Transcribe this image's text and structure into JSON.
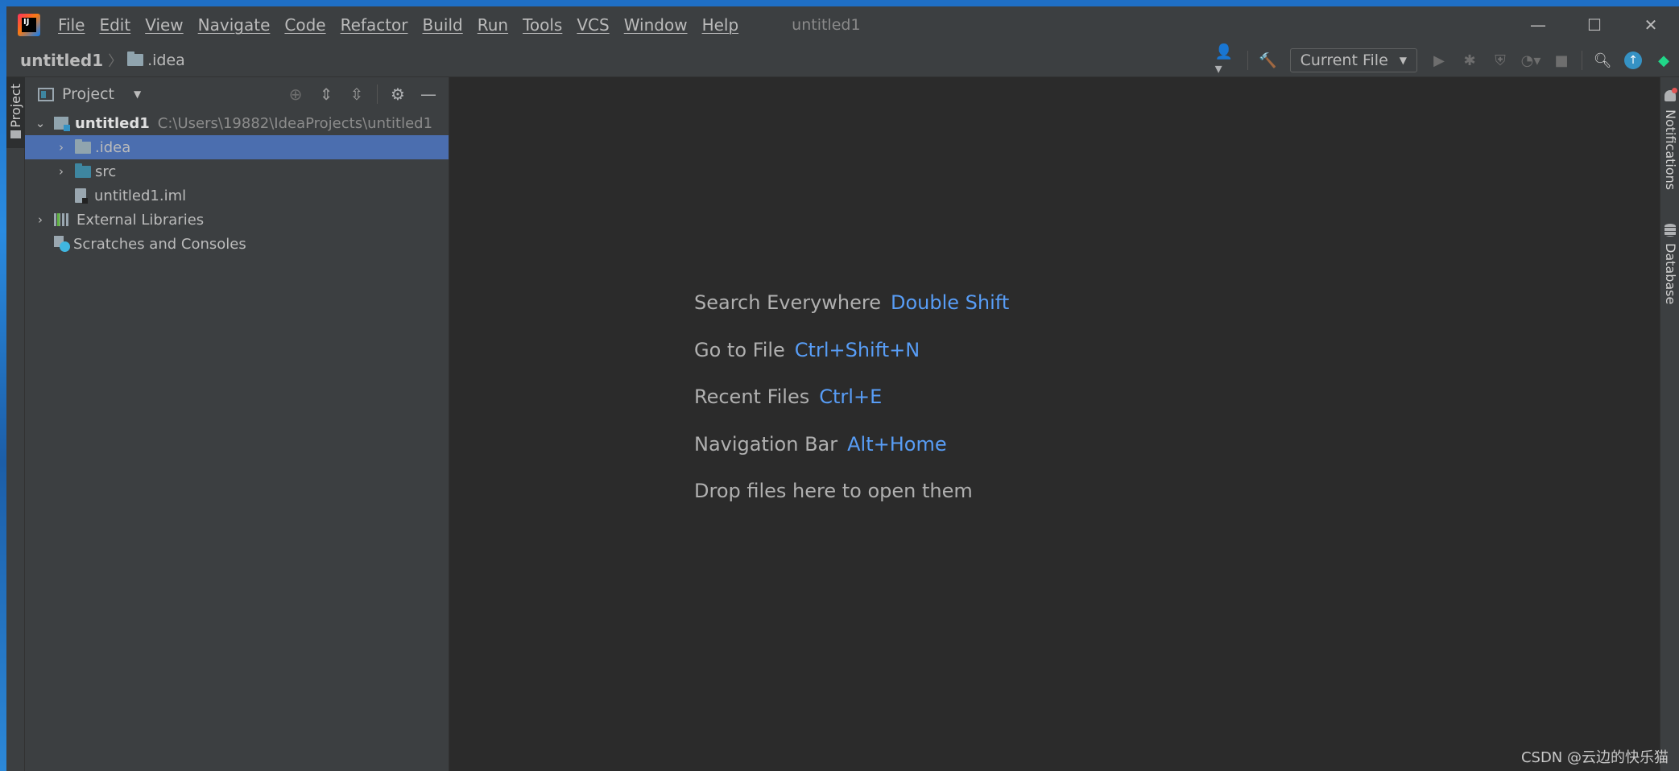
{
  "titlebar": {
    "menu": [
      "File",
      "Edit",
      "View",
      "Navigate",
      "Code",
      "Refactor",
      "Build",
      "Run",
      "Tools",
      "VCS",
      "Window",
      "Help"
    ],
    "window_title": "untitled1",
    "controls": {
      "minimize": "—",
      "maximize": "☐",
      "close": "✕"
    }
  },
  "navbar": {
    "breadcrumb_root": "untitled1",
    "breadcrumb_sep": "〉",
    "breadcrumb_item": ".idea",
    "run_config": "Current File",
    "icons": [
      "user-icon",
      "build-hammer-icon",
      "run-icon",
      "debug-icon",
      "coverage-icon",
      "profile-icon",
      "stop-icon",
      "search-icon",
      "update-icon",
      "jetbrains-icon"
    ]
  },
  "left_stripe": {
    "project_tab": "Project"
  },
  "project_panel": {
    "title": "Project",
    "tree": {
      "root_name": "untitled1",
      "root_path": "C:\\Users\\19882\\IdeaProjects\\untitled1",
      "children": [
        ".idea",
        "src",
        "untitled1.iml"
      ],
      "external": "External Libraries",
      "scratches": "Scratches and Consoles"
    }
  },
  "editor": {
    "hints": [
      {
        "label": "Search Everywhere",
        "key": "Double Shift"
      },
      {
        "label": "Go to File",
        "key": "Ctrl+Shift+N"
      },
      {
        "label": "Recent Files",
        "key": "Ctrl+E"
      },
      {
        "label": "Navigation Bar",
        "key": "Alt+Home"
      },
      {
        "label": "Drop files here to open them",
        "key": ""
      }
    ]
  },
  "right_stripe": {
    "notifications": "Notifications",
    "database": "Database"
  },
  "watermark": "CSDN @云边的快乐猫",
  "colors": {
    "accent": "#589df6",
    "selection": "#4b6eaf",
    "panel": "#3c3f41",
    "editor": "#2b2b2b"
  }
}
